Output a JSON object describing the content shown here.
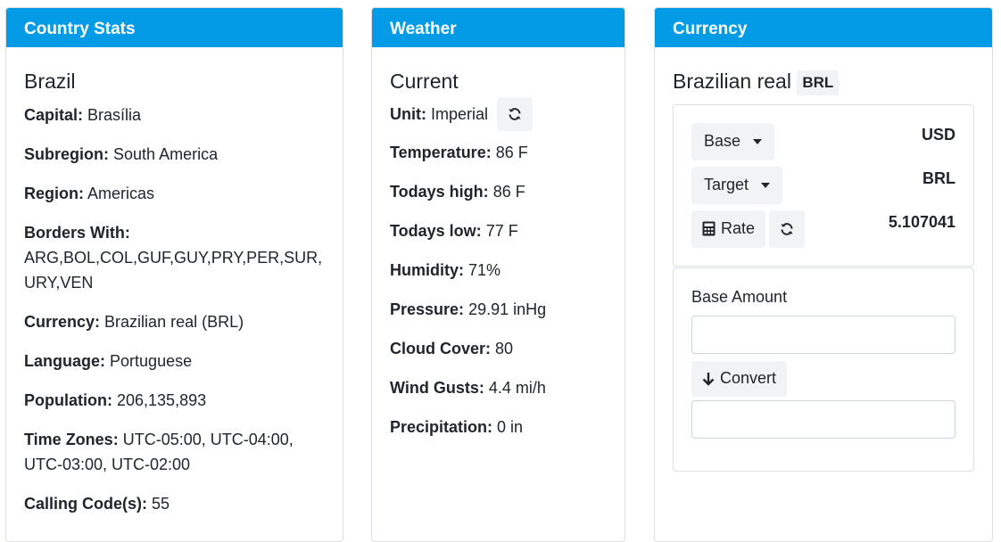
{
  "country": {
    "header": "Country Stats",
    "name": "Brazil",
    "rows": [
      {
        "label": "Capital:",
        "value": "Brasília"
      },
      {
        "label": "Subregion:",
        "value": "South America"
      },
      {
        "label": "Region:",
        "value": "Americas"
      },
      {
        "label": "Borders With:",
        "value": "ARG,BOL,COL,GUF,GUY,PRY,PER,SUR,URY,VEN"
      },
      {
        "label": "Currency:",
        "value": "Brazilian real (BRL)"
      },
      {
        "label": "Language:",
        "value": "Portuguese"
      },
      {
        "label": "Population:",
        "value": "206,135,893"
      },
      {
        "label": "Time Zones:",
        "value": "UTC-05:00, UTC-04:00, UTC-03:00, UTC-02:00"
      },
      {
        "label": "Calling Code(s):",
        "value": "55"
      }
    ]
  },
  "weather": {
    "header": "Weather",
    "title": "Current",
    "unit_label": "Unit:",
    "unit_value": "Imperial",
    "rows": [
      {
        "label": "Temperature:",
        "value": "86 F"
      },
      {
        "label": "Todays high:",
        "value": "86 F"
      },
      {
        "label": "Todays low:",
        "value": "77 F"
      },
      {
        "label": "Humidity:",
        "value": "71%"
      },
      {
        "label": "Pressure:",
        "value": "29.91 inHg"
      },
      {
        "label": "Cloud Cover:",
        "value": "80"
      },
      {
        "label": "Wind Gusts:",
        "value": "4.4 mi/h"
      },
      {
        "label": "Precipitation:",
        "value": "0 in"
      }
    ]
  },
  "currency": {
    "header": "Currency",
    "name": "Brazilian real",
    "code": "BRL",
    "base_label": "Base",
    "base_value": "USD",
    "target_label": "Target",
    "target_value": "BRL",
    "rate_label": "Rate",
    "rate_value": "5.107041",
    "amount_label": "Base Amount",
    "convert_label": "Convert",
    "base_amount": "",
    "converted_amount": ""
  },
  "colors": {
    "header_bg": "#039be5",
    "button_bg": "#f1f3f5"
  },
  "icons": [
    "refresh-icon",
    "calculator-icon",
    "arrow-down-icon",
    "caret-down-icon"
  ]
}
